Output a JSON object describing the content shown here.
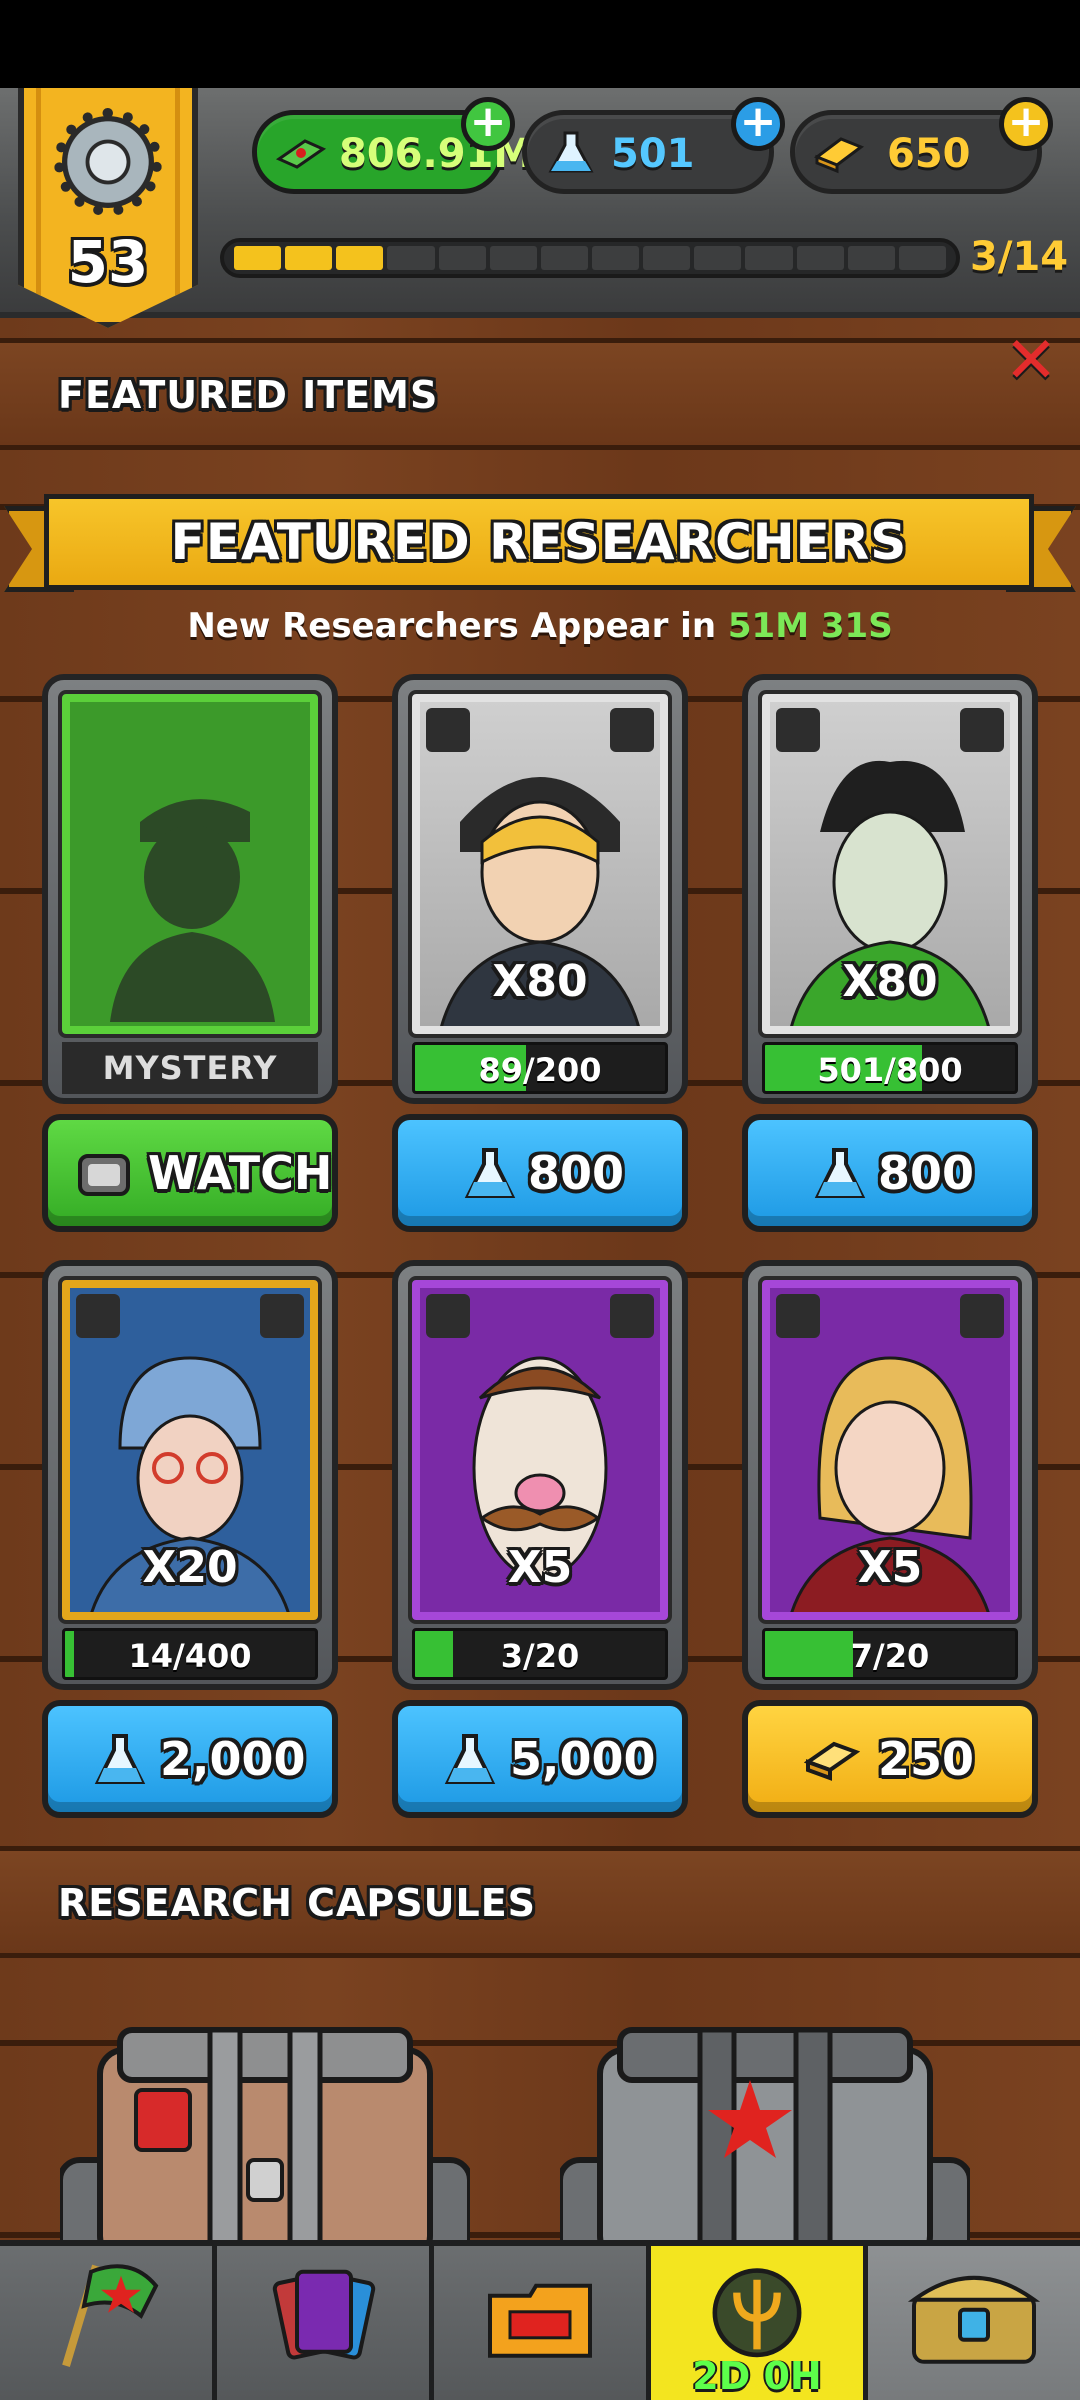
{
  "top_bar": {
    "level": "53",
    "cash": {
      "value": "806.91M",
      "icon": "cash-icon"
    },
    "flasks": {
      "value": "501",
      "icon": "flask-icon"
    },
    "gold": {
      "value": "650",
      "icon": "gold-bar-icon"
    },
    "xp_progress": {
      "text": "3/14",
      "filled": 3,
      "total": 14
    }
  },
  "sections": {
    "featured_items": "FEATURED ITEMS",
    "featured_researchers": "FEATURED RESEARCHERS",
    "research_capsules": "RESEARCH CAPSULES"
  },
  "timer": {
    "prefix": "New Researchers Appear in",
    "time": "51M 31S"
  },
  "researchers": [
    {
      "label": "MYSTERY",
      "button": "WATCH",
      "button_icon": "tv-icon",
      "frame": "green"
    },
    {
      "multiplier": "X80",
      "progress": "89/200",
      "progress_fraction": 0.445,
      "price": "800",
      "price_icon": "flask-icon",
      "frame": "gray"
    },
    {
      "multiplier": "X80",
      "progress": "501/800",
      "progress_fraction": 0.626,
      "price": "800",
      "price_icon": "flask-icon",
      "frame": "gray"
    },
    {
      "multiplier": "X20",
      "progress": "14/400",
      "progress_fraction": 0.035,
      "price": "2,000",
      "price_icon": "flask-icon",
      "frame": "gold"
    },
    {
      "multiplier": "X5",
      "progress": "3/20",
      "progress_fraction": 0.15,
      "price": "5,000",
      "price_icon": "flask-icon",
      "frame": "purple"
    },
    {
      "multiplier": "X5",
      "progress": "7/20",
      "progress_fraction": 0.35,
      "price": "250",
      "price_icon": "gold-bar-icon",
      "frame": "purple"
    }
  ],
  "bottom_nav": {
    "tabs": [
      "flag-star-icon",
      "cards-icon",
      "folder-icon",
      "trident-emblem-icon",
      "treasure-chest-icon"
    ],
    "active_timer": "2D 0H"
  },
  "colors": {
    "gold_accent": "#f3b420",
    "flask_blue": "#2b9de6",
    "cash_green": "#28a52a",
    "wood": "#6e3a1b",
    "timer_green": "#7ce857"
  }
}
